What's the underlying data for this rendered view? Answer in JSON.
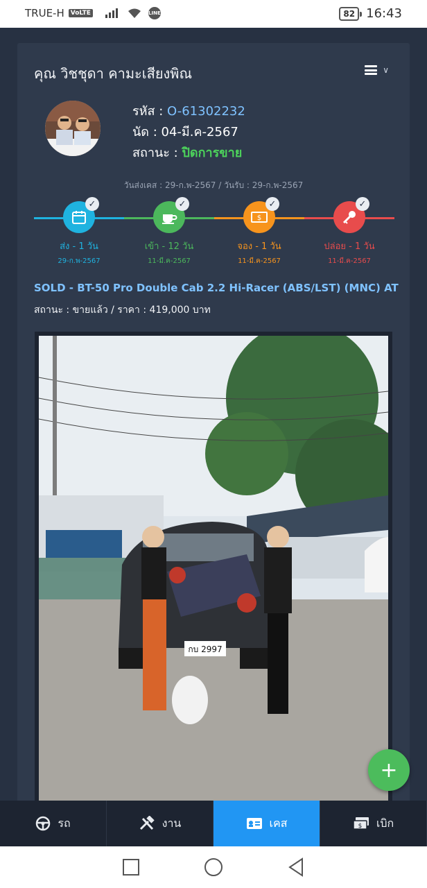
{
  "status_bar": {
    "carrier": "TRUE-H",
    "volte": "VoLTE",
    "line": "LINE",
    "battery": "82",
    "time": "16:43"
  },
  "header": {
    "customer_name": "คุณ วิชชุดา คามะเสียงพิณ"
  },
  "profile": {
    "code_label": "รหัส :",
    "code_value": "O-61302232",
    "appt_label": "นัด :",
    "appt_value": "04-มี.ค-2567",
    "status_label": "สถานะ :",
    "status_value": "ปิดการขาย"
  },
  "dates_line": "วันส่งเคส : 29-ก.พ-2567 / วันรับ : 29-ก.พ-2567",
  "timeline": [
    {
      "label": "ส่ง - 1 วัน",
      "date": "29-ก.พ-2567",
      "color": "#1fb3e0",
      "icon": "calendar-icon"
    },
    {
      "label": "เข้า - 12 วัน",
      "date": "11-มี.ค-2567",
      "color": "#4cb85c",
      "icon": "coffee-icon"
    },
    {
      "label": "จอง - 1 วัน",
      "date": "11-มี.ค-2567",
      "color": "#f7941d",
      "icon": "money-icon"
    },
    {
      "label": "ปล่อย - 1 วัน",
      "date": "11-มี.ค-2567",
      "color": "#e84c4c",
      "icon": "key-icon"
    }
  ],
  "listing": {
    "title": "SOLD - BT-50 Pro Double Cab 2.2 Hi-Racer (ABS/LST) (MNC) AT",
    "status_line": "สถานะ : ขายแล้ว / ราคา : 419,000 บาท",
    "plate_text": "กบ 2997"
  },
  "bottom_nav": [
    {
      "label": "รถ",
      "icon": "steering-wheel-icon",
      "active": false
    },
    {
      "label": "งาน",
      "icon": "tools-icon",
      "active": false
    },
    {
      "label": "เคส",
      "icon": "id-card-icon",
      "active": true
    },
    {
      "label": "เบิก",
      "icon": "cash-icon",
      "active": false
    }
  ],
  "colors": {
    "background": "#273142",
    "card": "#2f3a4c",
    "link_blue": "#7fc2ff",
    "status_green": "#4cd15b",
    "nav_active": "#2196f3",
    "fab": "#4cbc5c"
  }
}
